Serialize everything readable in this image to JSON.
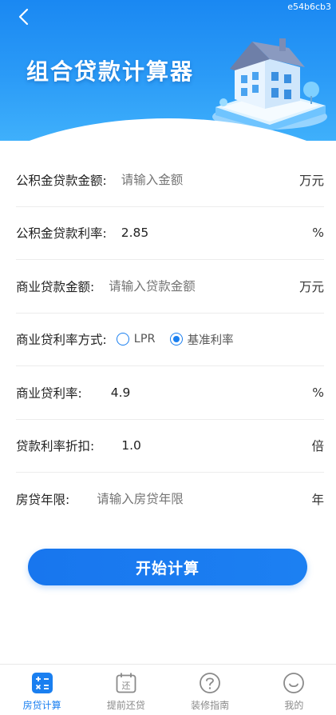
{
  "header": {
    "title": "组合贷款计算器",
    "hash": "e54b6cb3",
    "back_icon": "chevron-left-icon"
  },
  "form": {
    "fund_amount": {
      "label": "公积金贷款金额:",
      "value": "",
      "placeholder": "请输入金额",
      "unit": "万元"
    },
    "fund_rate": {
      "label": "公积金贷款利率:",
      "value": "2.85",
      "placeholder": "",
      "unit": "%"
    },
    "commercial_amount": {
      "label": "商业贷款金额:",
      "value": "",
      "placeholder": "请输入贷款金额",
      "unit": "万元"
    },
    "rate_mode": {
      "label": "商业贷利率方式:",
      "options": [
        {
          "label": "LPR",
          "selected": false
        },
        {
          "label": "基准利率",
          "selected": true
        }
      ]
    },
    "commercial_rate": {
      "label": "商业贷利率:",
      "value": "4.9",
      "placeholder": "",
      "unit": "%"
    },
    "discount": {
      "label": "贷款利率折扣:",
      "value": "1.0",
      "placeholder": "",
      "unit": "倍"
    },
    "years": {
      "label": "房贷年限:",
      "value": "",
      "placeholder": "请输入房贷年限",
      "unit": "年"
    }
  },
  "calc_button": {
    "label": "开始计算"
  },
  "bottom_nav": [
    {
      "label": "房贷计算",
      "icon": "calculator-icon",
      "active": true
    },
    {
      "label": "提前还贷",
      "icon": "calendar-repay-icon",
      "active": false
    },
    {
      "label": "装修指南",
      "icon": "question-circle-icon",
      "active": false
    },
    {
      "label": "我的",
      "icon": "smiley-icon",
      "active": false
    }
  ],
  "colors": {
    "primary": "#1a7ff0",
    "header_top": "#1a88f2",
    "header_bottom": "#3fb0fb",
    "nav_inactive": "#8a8a8a",
    "placeholder": "#bdbdbd"
  }
}
